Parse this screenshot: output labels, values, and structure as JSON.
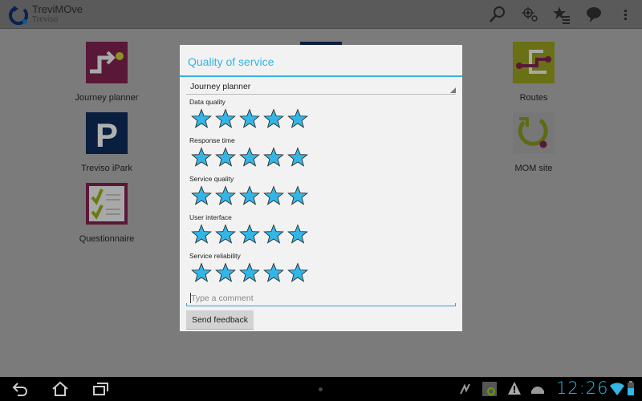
{
  "app": {
    "title": "TreviMOve",
    "subtitle": "Treviso"
  },
  "actionbar_icons": [
    "search-icon",
    "locate-search-icon",
    "favorites-list-icon",
    "feedback-bubble-icon",
    "overflow-menu-icon"
  ],
  "grid": [
    {
      "label": "Journey planner",
      "color": "#7a1848"
    },
    {
      "label": "Treviso iPark",
      "color": "#0a2a5a"
    },
    {
      "label": "Questionnaire",
      "color": "#7a1848"
    },
    {
      "label": "Routes",
      "color": "#8f9a1c"
    },
    {
      "label": "MOM site",
      "color": "#9a9a9a"
    }
  ],
  "dialog": {
    "title": "Quality of service",
    "service_selected": "Journey planner",
    "ratings": [
      {
        "label": "Data quality",
        "stars": 5,
        "max": 5
      },
      {
        "label": "Response time",
        "stars": 5,
        "max": 5
      },
      {
        "label": "Service quality",
        "stars": 5,
        "max": 5
      },
      {
        "label": "User interface",
        "stars": 5,
        "max": 5
      },
      {
        "label": "Service reliability",
        "stars": 5,
        "max": 5
      }
    ],
    "comment_placeholder": "Type a comment",
    "send_label": "Send feedback"
  },
  "status": {
    "time": "12:26"
  },
  "colors": {
    "accent": "#33b5e5",
    "star": "#33b5e5"
  }
}
